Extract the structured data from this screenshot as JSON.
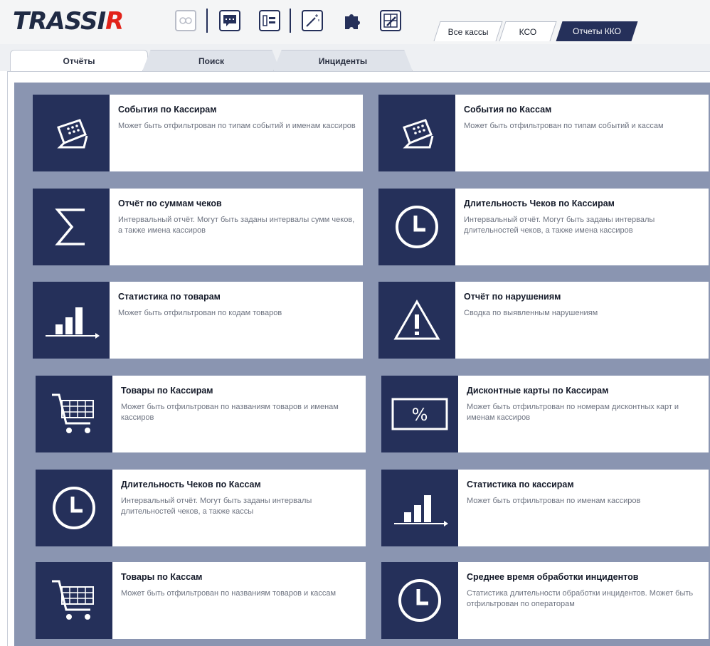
{
  "app": {
    "logo_main": "TRASSI",
    "logo_accent": "R"
  },
  "toolbar": {
    "icons": [
      "camera-group-icon",
      "chat-icon",
      "layout-icon",
      "magic-wand-icon",
      "puzzle-icon",
      "edit-layout-icon"
    ]
  },
  "mode_tabs": [
    "Все кассы",
    "КСО",
    "Отчеты ККО"
  ],
  "sub_tabs": [
    "Отчёты",
    "Поиск",
    "Инциденты"
  ],
  "colors": {
    "accent": "#25305a",
    "background": "#8a95b1",
    "logo_red": "#e2231a"
  },
  "cards": [
    {
      "icon": "cash-register-icon",
      "title": "События по Кассирам",
      "desc": "Может быть отфильтрован по типам событий и именам кассиров"
    },
    {
      "icon": "cash-register-icon",
      "title": "События по Кассам",
      "desc": "Может быть отфильтрован по типам событий и кассам"
    },
    {
      "icon": "sigma-icon",
      "title": "Отчёт по суммам чеков",
      "desc": "Интервальный отчёт. Могут быть заданы интервалы сумм чеков, а также имена кассиров"
    },
    {
      "icon": "clock-icon",
      "title": "Длительность Чеков по Кассирам",
      "desc": "Интервальный отчёт. Могут быть заданы интервалы длительностей чеков, а также имена кассиров"
    },
    {
      "icon": "bar-chart-icon",
      "title": "Статистика по товарам",
      "desc": "Может быть отфильтрован по кодам товаров"
    },
    {
      "icon": "warning-icon",
      "title": "Отчёт по нарушениям",
      "desc": "Сводка по выявленным нарушениям"
    },
    {
      "icon": "cart-icon",
      "title": "Товары по Кассирам",
      "desc": "Может быть отфильтрован по названиям товаров и именам кассиров"
    },
    {
      "icon": "percent-icon",
      "title": "Дисконтные карты по Кассирам",
      "desc": "Может быть отфильтрован по номерам дисконтных карт и именам кассиров"
    },
    {
      "icon": "clock-icon",
      "title": "Длительность Чеков по Кассам",
      "desc": "Интервальный отчёт. Могут быть заданы интервалы длительностей чеков, а также кассы"
    },
    {
      "icon": "bar-chart-icon",
      "title": "Статистика по кассирам",
      "desc": "Может быть отфильтрован по именам кассиров"
    },
    {
      "icon": "cart-icon",
      "title": "Товары по Кассам",
      "desc": "Может быть отфильтрован по названиям товаров и кассам"
    },
    {
      "icon": "clock-icon",
      "title": "Среднее время обработки инцидентов",
      "desc": "Статистика длительности обработки инцидентов. Может быть отфильтрован по операторам"
    }
  ]
}
